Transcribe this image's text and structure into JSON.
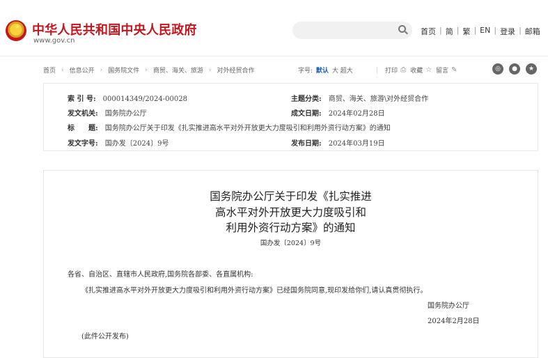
{
  "header": {
    "site_title": "中华人民共和国中央人民政府",
    "site_url": "www.gov.cn",
    "search_placeholder": "",
    "nav": [
      "首页",
      "简",
      "繁",
      "EN",
      "登录",
      "邮箱"
    ]
  },
  "breadcrumb": [
    "首页",
    "信息公开",
    "国务院文件",
    "商贸、海关、旅游",
    "对外经贸合作"
  ],
  "font_size": {
    "label": "字号:",
    "options": [
      "默认",
      "大",
      "超大"
    ]
  },
  "tools": {
    "print": "打印",
    "favorite": "收藏",
    "comment": "留言"
  },
  "meta": {
    "index_label": "索 引 号:",
    "index_value": "000014349/2024-00028",
    "category_label": "主题分类:",
    "category_value": "商贸、海关、旅游\\对外经贸合作",
    "issuer_label": "发文机关:",
    "issuer_value": "国务院办公厅",
    "date_written_label": "成文日期:",
    "date_written_value": "2024年02月28日",
    "title_label": "标　　题:",
    "title_value": "国务院办公厅关于印发《扎实推进高水平对外开放更大力度吸引和利用外资行动方案》的通知",
    "doc_no_label": "发文字号:",
    "doc_no_value": "国办发〔2024〕9号",
    "publish_label": "发布日期:",
    "publish_value": "2024年03月19日"
  },
  "document": {
    "title_line1": "国务院办公厅关于印发《扎实推进",
    "title_line2": "高水平对外开放更大力度吸引和",
    "title_line3": "利用外资行动方案》的通知",
    "doc_no": "国办发〔2024〕9号",
    "salutation": "各省、自治区、直辖市人民政府,国务院各部委、各直属机构:",
    "body": "《扎实推进高水平对外开放更大力度吸引和利用外资行动方案》已经国务院同意,现印发给你们,请认真贯彻执行。",
    "signer": "国务院办公厅",
    "date": "2024年2月28日",
    "note": "(此件公开发布)"
  }
}
